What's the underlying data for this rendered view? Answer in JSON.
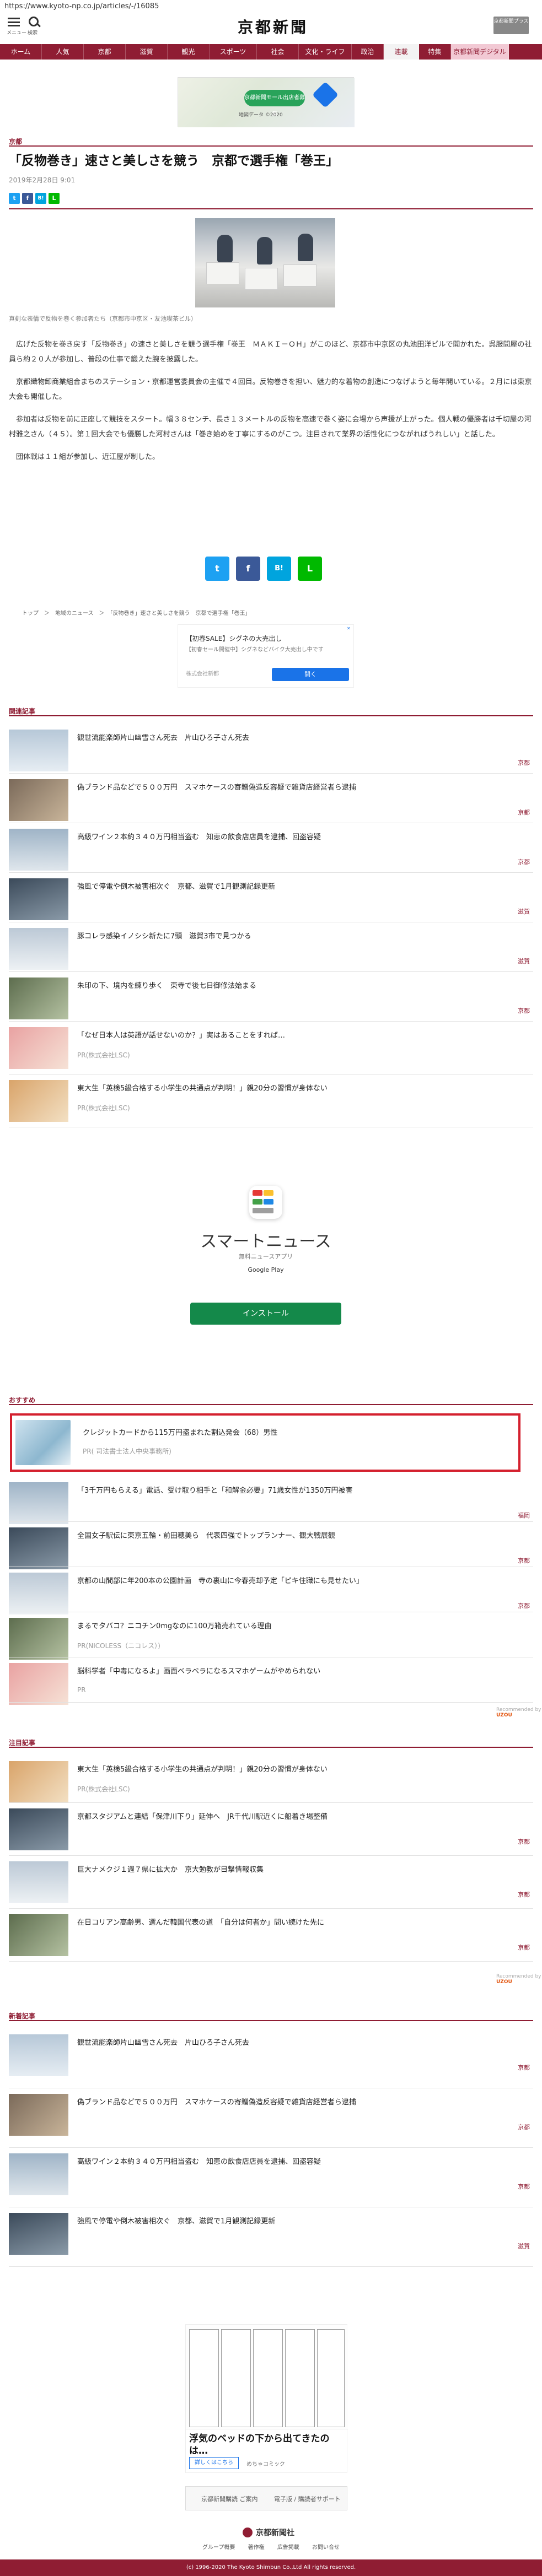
{
  "browser": {
    "url": "https://www.kyoto-np.co.jp/articles/-/16085"
  },
  "header": {
    "menu_label": "メニュー",
    "search_label": "検索",
    "logo": "京都新聞",
    "plus_label": "京都新聞プラス"
  },
  "nav": {
    "items": [
      {
        "label": "ホーム",
        "w": 76
      },
      {
        "label": "人気",
        "w": 76
      },
      {
        "label": "京都",
        "w": 76
      },
      {
        "label": "滋賀",
        "w": 76
      },
      {
        "label": "観光",
        "w": 76
      },
      {
        "label": "スポーツ",
        "w": 86
      },
      {
        "label": "社会",
        "w": 76
      },
      {
        "label": "文化・ライフ",
        "w": 96
      },
      {
        "label": "政治",
        "w": 58
      },
      {
        "label": "連載",
        "w": 64
      },
      {
        "label": "特集",
        "w": 58
      },
      {
        "label": "京都新聞デジタル",
        "w": 105
      }
    ],
    "active_index": 9,
    "special_index": 11
  },
  "ad_top": {
    "button": "京都新聞モール出店者募集",
    "note": "地図データ ©2020"
  },
  "article": {
    "section": "京都",
    "title": "「反物巻き」速さと美しさを競う　京都で選手権「巻王」",
    "date": "2019年2月28日 9:01",
    "caption": "真剣な表情で反物を巻く参加者たち（京都市中京区・友池喫茶ビル）",
    "paragraphs": [
      "広げた反物を巻き戻す「反物巻き」の速さと美しさを競う選手権「巻王　ＭＡＫＩ－ＯＨ」がこのほど、京都市中京区の丸池田洋ビルで開かれた。呉服問屋の社員ら約２０人が参加し、普段の仕事で鍛えた腕を披露した。",
      "京都織物卸商業組合まちのステーション・京都運営委員会の主催で４回目。反物巻きを担い、魅力的な着物の創造につなげようと毎年開いている。２月には東京大会も開催した。",
      "参加者は反物を前に正座して競技をスタート。幅３８センチ、長さ１３メートルの反物を高速で巻く姿に会場から声援が上がった。個人戦の優勝者は千切屋の河村雅之さん（４５）。第１回大会でも優勝した河村さんは「巻き始めを丁寧にするのがこつ。注目されて業界の活性化につながればうれしい」と話した。",
      "団体戦は１１組が参加し、近江屋が制した。"
    ]
  },
  "share": {
    "twitter": "t",
    "facebook": "f",
    "hatena": "B!",
    "line": "L"
  },
  "breadcrumb": "トップ　＞　地域のニュース　＞　「反物巻き」速さと美しさを競う　京都で選手権「巻王」",
  "ad_mid": {
    "line1": "【初春SALE】シグネの大売出し",
    "line2": "【初春セール開催中】シグネなどバイク大売出し中です",
    "line3": "株式会社新都",
    "button": "開く"
  },
  "related": {
    "heading": "関連記事",
    "items": [
      {
        "title": "観世流能楽師片山幽雪さん死去　片山ひろ子さん死去",
        "cat": "京都"
      },
      {
        "title": "偽ブランド品などで５００万円　スマホケースの寄贈偽造反容疑で雑貨店経営者ら逮捕",
        "cat": "京都"
      },
      {
        "title": "高級ワイン２本約３４０万円相当盗む　知恵の飲食店店員を逮捕、回盗容疑",
        "cat": "京都"
      },
      {
        "title": "強風で停電や倒木被害相次ぐ　京都、滋賀で1月観測記録更新",
        "cat": "滋賀"
      },
      {
        "title": "豚コレラ感染イノシシ新たに7頭　滋賀3市で見つかる",
        "cat": "滋賀"
      },
      {
        "title": "朱印の下、境内を練り歩く　東寺で後七日御修法始まる",
        "cat": "京都"
      }
    ],
    "pr_items": [
      {
        "title": "「なぜ日本人は英語が話せないのか？」実はあることをすれば…",
        "pr": "PR(株式会社LSC)"
      },
      {
        "title": "東大生「英検5級合格する小学生の共通点が判明！」親20分の習慣が身体ない",
        "pr": "PR(株式会社LSC)"
      }
    ]
  },
  "smartnews": {
    "name": "スマートニュース",
    "sub": "無料ニュースアプリ",
    "store": "Google Play",
    "install": "インストール"
  },
  "recommend": {
    "heading": "おすすめ",
    "highlight": {
      "title": "クレジットカードから115万円盗まれた割込発会（68）男性",
      "pr": "PR( 司法書士法人中央事務所)"
    },
    "items": [
      {
        "title": "「3千万円もらえる」電話、受け取り相手と「和解金必要」71歳女性が1350万円被害",
        "cat": "福岡"
      },
      {
        "title": "全国女子駅伝に東京五輪・前田穂美ら　代表四強でトップランナー、観大戦展観",
        "cat": "京都"
      },
      {
        "title": "京都の山間部に年200本の公園計画　寺の裏山に今春売却予定「ピキ住職にも見せたい」",
        "cat": "京都"
      },
      {
        "title": "まるでタバコ？ニコチン0mgなのに100万箱売れている理由",
        "cat": "",
        "pr": "PR(NICOLESS（ニコレス）)"
      },
      {
        "title": "脳科学者「中毒になるよ」画面ベラベラになるスマホゲームがやめられない",
        "cat": "",
        "pr": "PR"
      }
    ],
    "recommended_by": "Recommended by"
  },
  "attention": {
    "heading": "注目記事",
    "pr_items": [
      {
        "title": "東大生「英検5級合格する小学生の共通点が判明！」親20分の習慣が身体ない",
        "pr": "PR(株式会社LSC)"
      }
    ],
    "items": [
      {
        "title": "京都スタジアムと連結「保津川下り」延伸へ　JR千代川駅近くに船着き場整備",
        "cat": "京都"
      },
      {
        "title": "巨大ナメクジ１週７県に拡大か　京大勉教が目撃情報収集",
        "cat": "京都"
      },
      {
        "title": "在日コリアン高齢男、選んだ韓国代表の道　「自分は何者か」問い続けた先に",
        "cat": "京都"
      }
    ],
    "recommended_by": "Recommended by"
  },
  "latest": {
    "heading": "新着記事",
    "items": [
      {
        "title": "観世流能楽師片山幽雪さん死去　片山ひろ子さん死去",
        "cat": "京都"
      },
      {
        "title": "偽ブランド品などで５００万円　スマホケースの寄贈偽造反容疑で雑貨店経営者ら逮捕",
        "cat": "京都"
      },
      {
        "title": "高級ワイン２本約３４０万円相当盗む　知恵の飲食店店員を逮捕、回盗容疑",
        "cat": "京都"
      },
      {
        "title": "強風で停電や倒木被害相次ぐ　京都、滋賀で1月観測記録更新",
        "cat": "滋賀"
      }
    ]
  },
  "ad_bottom": {
    "title": "浮気のベッドの下から出てきたの は…",
    "more": "詳しくはこちら",
    "src": "めちゃコミック"
  },
  "footer": {
    "btn1": "京都新聞購読 ご案内",
    "btn2": "電子版 / 購読者サポート",
    "logo": "京都新聞社",
    "links": [
      "グループ概要",
      "著作権",
      "広告掲載",
      "お問い合せ"
    ],
    "copyright": "(c) 1996-2020 The Kyoto Shimbun Co.,Ltd All rights reserved."
  },
  "colors": {
    "brand": "#8f1d33",
    "highlight_border": "#d4202e",
    "twitter": "#1da1f2",
    "facebook": "#3b5998",
    "hatena": "#00a4de",
    "line": "#00b900"
  }
}
